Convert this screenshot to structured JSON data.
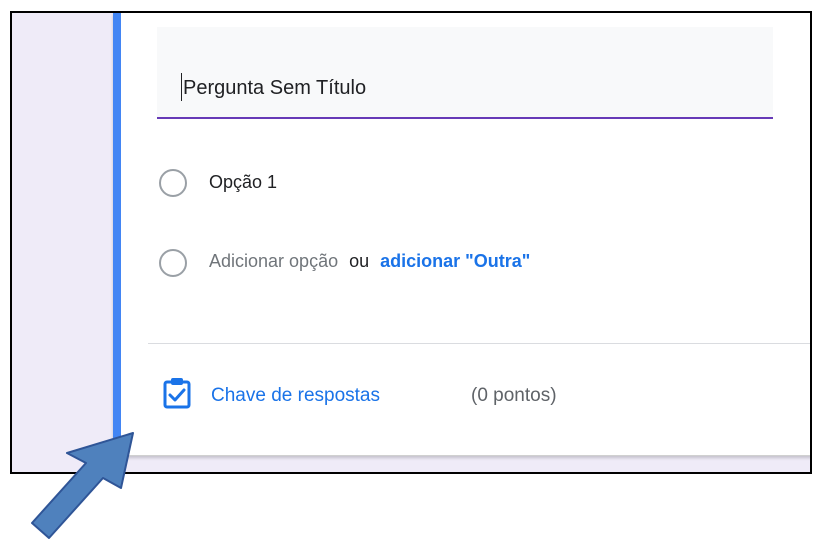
{
  "question": {
    "title": "Pergunta Sem Título"
  },
  "options": {
    "option1_label": "Opção 1",
    "add_option_label": "Adicionar opção",
    "or_label": "ou",
    "add_other_label": "adicionar \"Outra\""
  },
  "footer": {
    "answer_key_label": "Chave de respostas",
    "points_label": "(0 pontos)"
  },
  "icons": {
    "answer_key": "clipboard-check-icon",
    "radio": "radio-button-icon",
    "annotation": "arrow-icon"
  },
  "colors": {
    "accent": "#4285f4",
    "underline": "#673ab7",
    "link": "#1a73e8",
    "background": "#efebf8",
    "annotation_arrow": "#4f81bd"
  }
}
